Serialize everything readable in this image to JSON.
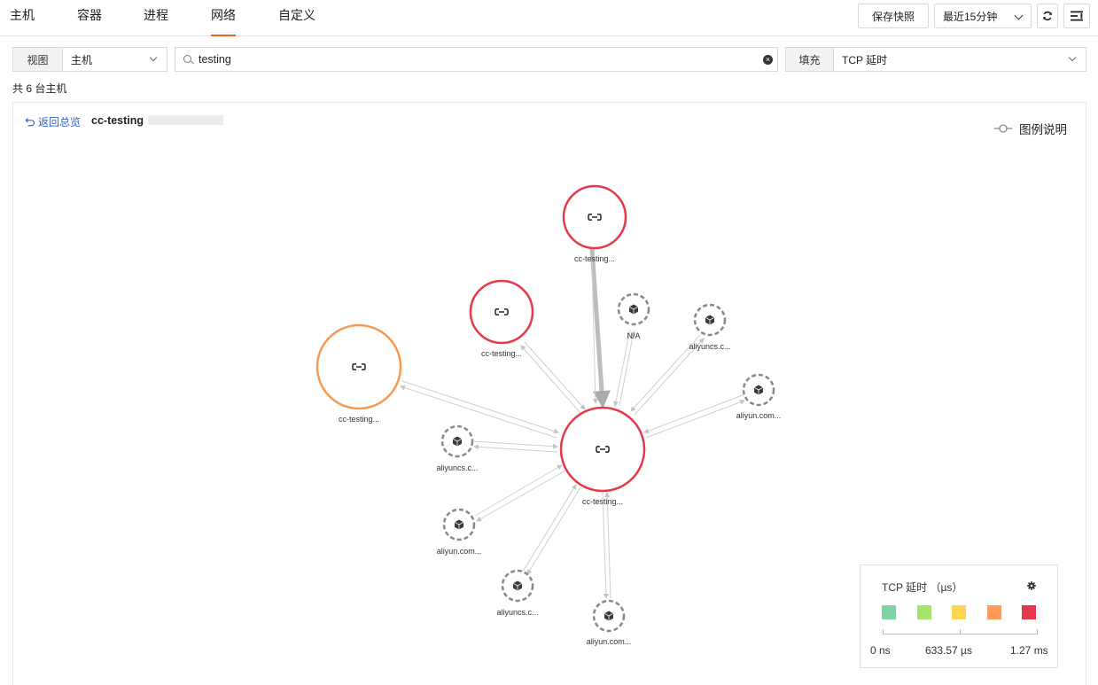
{
  "tabs": [
    "主机",
    "容器",
    "进程",
    "网络",
    "自定义"
  ],
  "active_tab": "网络",
  "toolbar": {
    "save_snapshot": "保存快照",
    "time_range": "最近15分钟"
  },
  "filters": {
    "view_label": "视图",
    "view_value": "主机",
    "search_value": "testing",
    "fill_label": "填充",
    "fill_value": "TCP 延时"
  },
  "count_text": "共 6 台主机",
  "breadcrumb": {
    "back": "返回总览",
    "current": "cc-testing"
  },
  "legend_toggle": "图例说明",
  "graph": {
    "nodes": [
      {
        "id": "center",
        "label": "cc-testing...",
        "kind": "host",
        "color": "#e5394a"
      },
      {
        "id": "top",
        "label": "cc-testing...",
        "kind": "host",
        "color": "#e5394a"
      },
      {
        "id": "midleft",
        "label": "cc-testing...",
        "kind": "host",
        "color": "#e5394a"
      },
      {
        "id": "left",
        "label": "cc-testing...",
        "kind": "host",
        "color": "#f59a52"
      },
      {
        "id": "na",
        "label": "N/A",
        "kind": "external"
      },
      {
        "id": "ext1",
        "label": "aliyuncs.c...",
        "kind": "external"
      },
      {
        "id": "ext2",
        "label": "aliyun.com...",
        "kind": "external"
      },
      {
        "id": "ext3",
        "label": "aliyuncs.c...",
        "kind": "external"
      },
      {
        "id": "ext4",
        "label": "aliyun.com...",
        "kind": "external"
      },
      {
        "id": "ext5",
        "label": "aliyuncs.c...",
        "kind": "external"
      },
      {
        "id": "ext6",
        "label": "aliyun.com..."
      }
    ]
  },
  "tcp_legend": {
    "title": "TCP 延时 （µs）",
    "colors": [
      "#7fd3a5",
      "#a3e36f",
      "#ffd451",
      "#ff9a57",
      "#e5394a"
    ],
    "ticks": [
      "0 ns",
      "633.57 µs",
      "1.27 ms"
    ]
  }
}
